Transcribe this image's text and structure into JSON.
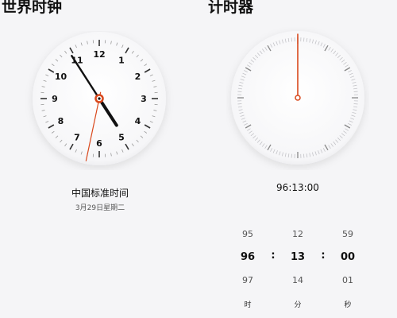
{
  "world_clock": {
    "title": "世界时钟",
    "zone_name": "中国标准时间",
    "date": "3月29日星期二",
    "face_numbers": [
      "12",
      "1",
      "2",
      "3",
      "4",
      "5",
      "6",
      "7",
      "8",
      "9",
      "10",
      "11"
    ],
    "time": {
      "hour": 4,
      "minute": 54,
      "second": 32
    },
    "colors": {
      "hands": "#111111",
      "second_hand": "#d9481c"
    }
  },
  "timer": {
    "title": "计时器",
    "readout": "96:13:00",
    "hours": {
      "prev": "95",
      "current": "96",
      "next": "97",
      "unit": "时"
    },
    "minutes": {
      "prev": "12",
      "current": "13",
      "next": "14",
      "unit": "分"
    },
    "seconds": {
      "prev": "59",
      "current": "00",
      "next": "01",
      "unit": "秒"
    },
    "separator": ":",
    "colors": {
      "hand": "#d9481c"
    }
  }
}
